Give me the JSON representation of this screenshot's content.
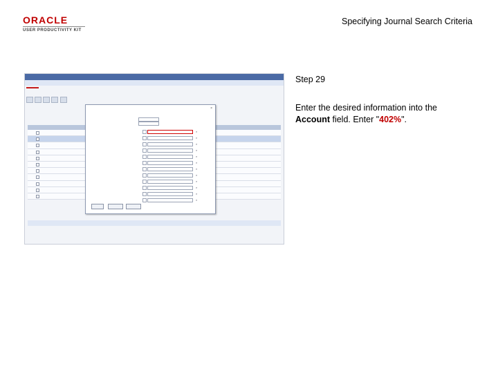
{
  "header": {
    "logo_top": "ORACLE",
    "logo_sub": "USER PRODUCTIVITY KIT",
    "page_title": "Specifying Journal Search Criteria"
  },
  "instruction": {
    "step": "Step 29",
    "line_prefix": "Enter the desired information into the ",
    "field_name": "Account",
    "line_middle": " field. Enter \"",
    "value": "402%",
    "line_suffix": "\"."
  },
  "colors": {
    "brand": "#c00000",
    "highlight": "#d40000",
    "nav": "#4a6aa5"
  }
}
